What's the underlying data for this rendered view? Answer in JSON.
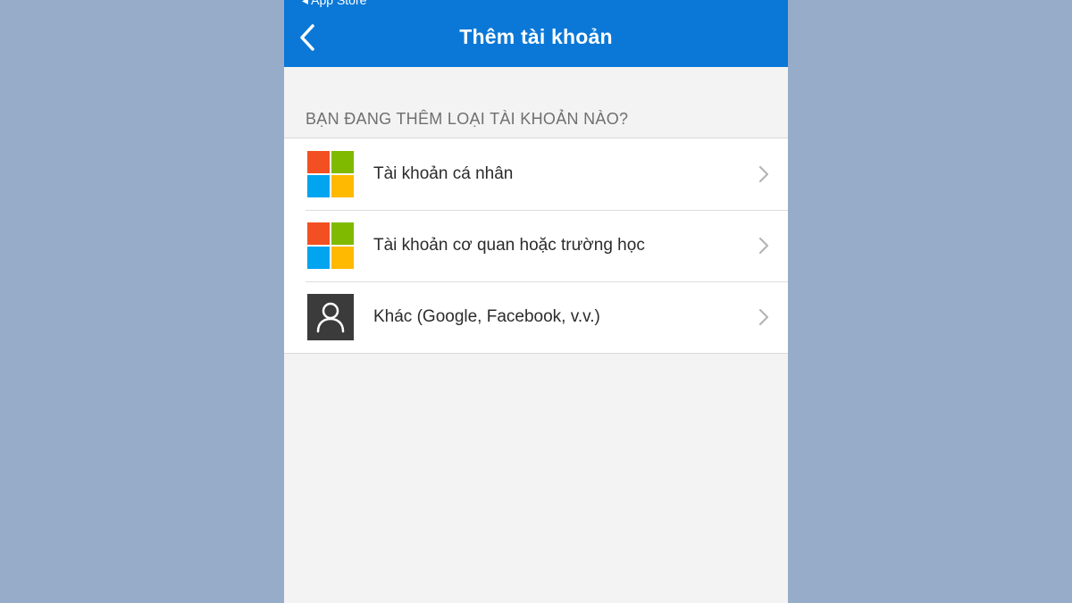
{
  "status_bar": {
    "back_app": "◂ App Store"
  },
  "header": {
    "title": "Thêm tài khoản"
  },
  "section": {
    "label": "BẠN ĐANG THÊM LOẠI TÀI KHOẢN NÀO?"
  },
  "account_types": [
    {
      "label": "Tài khoản cá nhân",
      "icon": "microsoft-logo-icon"
    },
    {
      "label": "Tài khoản cơ quan hoặc trường học",
      "icon": "microsoft-logo-icon"
    },
    {
      "label": "Khác (Google, Facebook, v.v.)",
      "icon": "user-icon"
    }
  ],
  "colors": {
    "header_blue": "#0b78d7",
    "background_outer": "#97acc8",
    "ms_red": "#f25022",
    "ms_green": "#7fba00",
    "ms_blue": "#00a4ef",
    "ms_yellow": "#ffb900"
  }
}
